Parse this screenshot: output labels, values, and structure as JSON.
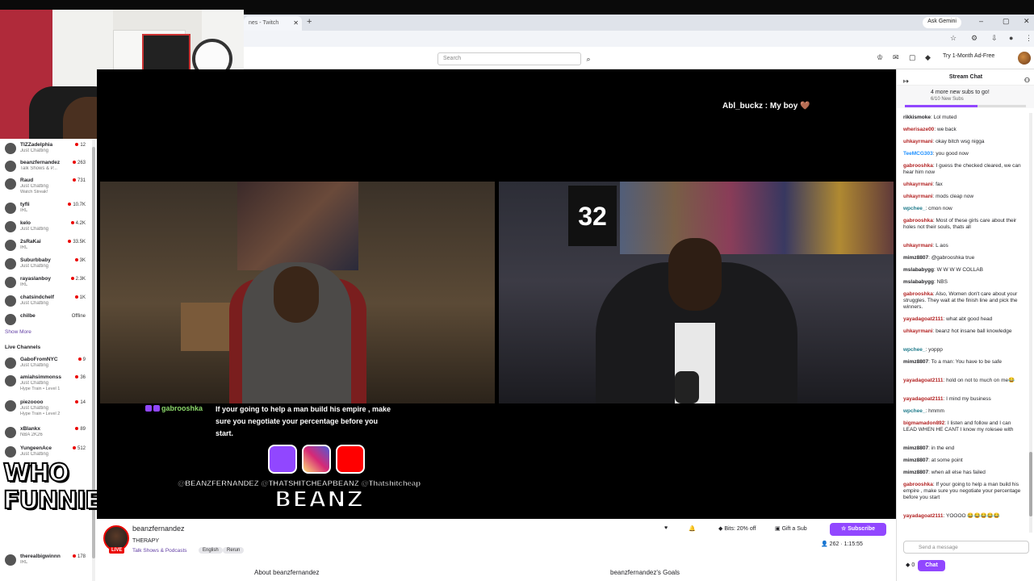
{
  "browser": {
    "tab_title": "nes - Twitch",
    "new_tab": "+",
    "ask_gemini": "Ask Gemini",
    "window_min": "–",
    "window_restore": "▢",
    "window_close": "✕"
  },
  "header": {
    "search_placeholder": "Search",
    "ad_free": "Try 1-Month Ad-Free"
  },
  "sidebar": {
    "followed": [
      {
        "name": "TIZZadelphia",
        "category": "Just Chatting",
        "sub": "",
        "count": "12"
      },
      {
        "name": "beanzfernandez",
        "category": "Talk Shows & P...",
        "sub": "",
        "count": "263"
      },
      {
        "name": "Raud",
        "category": "Just Chatting",
        "sub": "Watch Streak!",
        "count": "731"
      },
      {
        "name": "tyfli",
        "category": "IRL",
        "sub": "",
        "count": "10.7K"
      },
      {
        "name": "kelo",
        "category": "Just Chatting",
        "sub": "",
        "count": "4.2K"
      },
      {
        "name": "2sRaKai",
        "category": "IRL",
        "sub": "",
        "count": "33.5K"
      },
      {
        "name": "Suburbbaby",
        "category": "Just Chatting",
        "sub": "",
        "count": "3K"
      },
      {
        "name": "rayaslanboy",
        "category": "IRL",
        "sub": "",
        "count": "2.3K"
      },
      {
        "name": "chatsindchelf",
        "category": "Just Chatting",
        "sub": "",
        "count": "1K"
      },
      {
        "name": "chilbe",
        "category": "",
        "sub": "",
        "count": "Offline"
      }
    ],
    "show_more": "Show More",
    "live_channels_heading": "Live Channels",
    "live": [
      {
        "name": "GaboFromNYC",
        "category": "Just Chatting",
        "sub": "",
        "count": "9"
      },
      {
        "name": "amiahsimmonss",
        "category": "Just Chatting",
        "sub": "Hype Train • Level 1",
        "count": "36"
      },
      {
        "name": "piezoooo",
        "category": "Just Chatting",
        "sub": "Hype Train • Level 2",
        "count": "14"
      },
      {
        "name": "xBlankx",
        "category": "NBA 2K26",
        "sub": "",
        "count": "89"
      },
      {
        "name": "YungeenAce",
        "category": "Just Chatting",
        "sub": "",
        "count": "512"
      },
      {
        "name": "therealbigwinnn",
        "category": "IRL",
        "sub": "",
        "count": "178"
      }
    ]
  },
  "overlay": {
    "who_funnier": "WHO FUNNIER?",
    "top_chat": "Abl_buckz : My boy 🤎",
    "caption_user": "gabrooshka",
    "caption_text": "If your going to help a man build his empire , make sure you negotiate your percentage before you start.",
    "handles": "@BEANZFERNANDEZ  @THATSHITCHEAPBEANZ  @Thatshitcheap",
    "brand": "BEANZ"
  },
  "channel": {
    "name": "beanzfernandez",
    "title": "THERAPY",
    "category": "Talk Shows & Podcasts",
    "tags": [
      "English",
      "Rerun"
    ],
    "live_badge": "LIVE",
    "bits": "Bits: 20% off",
    "gift": "Gift a Sub",
    "subscribe": "Subscribe",
    "viewers": "262",
    "uptime": "1:15:55",
    "about": "About beanzfernandez",
    "goals": "beanzfernandez's Goals"
  },
  "chat": {
    "header": "Stream Chat",
    "goal_title": "4 more new subs to go!",
    "goal_sub": "6/10 New Subs",
    "goal_progress": 0.6,
    "messages": [
      {
        "user": "rikkismoke",
        "text": "Lol muted",
        "color": "#1f1f23"
      },
      {
        "user": "wherisaze00",
        "text": "we back",
        "color": "#b22222"
      },
      {
        "user": "uhkayrmani",
        "text": "okay bitch wsg nigga",
        "color": "#b22222"
      },
      {
        "user": "TeeMCG303",
        "text": "you good now",
        "color": "#1e90ff"
      },
      {
        "user": "gabrooshka",
        "text": "I guess the checked cleared, we can hear him now",
        "color": "#b22222"
      },
      {
        "user": "uhkayrmani",
        "text": "fax",
        "color": "#b22222"
      },
      {
        "user": "uhkayrmani",
        "text": "mods cleap now",
        "color": "#b22222"
      },
      {
        "user": "wpchee_",
        "text": "cmon now",
        "color": "#1e7a8a"
      },
      {
        "user": "gabrooshka",
        "text": "Most of these girls care about their holes not their souls, thats all",
        "color": "#b22222"
      },
      {
        "user": "uhkayrmani",
        "text": "L aos",
        "color": "#b22222"
      },
      {
        "user": "mimz8807",
        "text": "@gabrooshka true",
        "color": "#1f1f23"
      },
      {
        "user": "mslababygg",
        "text": "W W W W COLLAB",
        "color": "#1f1f23"
      },
      {
        "user": "mslababygg",
        "text": "NBS",
        "color": "#1f1f23"
      },
      {
        "user": "gabrooshka",
        "text": "Also, Women don't care about your struggles. They wait at the finish line and pick the winners.",
        "color": "#b22222"
      },
      {
        "user": "yayadagoat2111",
        "text": "what abt good head",
        "color": "#b22222"
      },
      {
        "user": "uhkayrmani",
        "text": "beanz hot insane ball knowledge",
        "color": "#b22222"
      },
      {
        "user": "wpchee_",
        "text": "yoppp",
        "color": "#1e7a8a"
      },
      {
        "user": "mimz8807",
        "text": "To a man: You have to be safe",
        "color": "#1f1f23"
      },
      {
        "user": "yayadagoat2111",
        "text": "hold on not to much on me😂",
        "color": "#b22222"
      },
      {
        "user": "yayadagoat2111",
        "text": "I mind my business",
        "color": "#b22222"
      },
      {
        "user": "wpchee_",
        "text": "hmmm",
        "color": "#1e7a8a"
      },
      {
        "user": "bigmamadon892",
        "text": "I listen and follow and I can LEAD WHEN HE CANT I know my rolesee with",
        "color": "#b22222"
      },
      {
        "user": "mimz8807",
        "text": "in the end",
        "color": "#1f1f23"
      },
      {
        "user": "mimz8807",
        "text": "at some point",
        "color": "#1f1f23"
      },
      {
        "user": "mimz8807",
        "text": "when all else has failed",
        "color": "#1f1f23"
      },
      {
        "user": "gabrooshka",
        "text": "If your going to help a man build his empire , make sure you negotiate your percentage before you start",
        "color": "#b22222"
      },
      {
        "user": "yayadagoat2111",
        "text": "YOOOO 😂😂😂😂😂",
        "color": "#b22222"
      }
    ],
    "input_placeholder": "Send a message",
    "points": "0",
    "send": "Chat"
  }
}
